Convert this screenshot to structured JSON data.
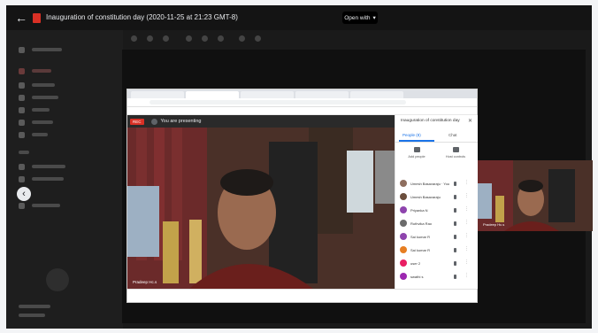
{
  "viewer": {
    "back_glyph": "←",
    "file_title": "Inauguration of constitution day (2020-11-25 at 21:23 GMT-8)",
    "open_with_label": "Open with",
    "open_with_caret": "▾",
    "nav_prev_glyph": "‹"
  },
  "meet": {
    "rec_badge": "REC",
    "presenting_text": "You are presenting",
    "presenter_name": "Pradeep Hc.s",
    "panel_title": "Inauguration of constitution day",
    "panel_close_glyph": "✕",
    "tabs": [
      {
        "label": "People (8)"
      },
      {
        "label": "Chat"
      }
    ],
    "actions": [
      {
        "label": "Add people"
      },
      {
        "label": "Host controls"
      }
    ],
    "participants": [
      {
        "name": "Umesh Basavaraju · You",
        "color": "#8e6e5e"
      },
      {
        "name": "Umesh Basavaraju",
        "color": "#6b4e3d"
      },
      {
        "name": "Priyanka N",
        "color": "#8e44ad"
      },
      {
        "name": "Ruthvika Rao",
        "color": "#6b6b6b"
      },
      {
        "name": "Sai kumar R",
        "color": "#8e44ad"
      },
      {
        "name": "Sai kumar R",
        "color": "#e67e22"
      },
      {
        "name": "user 2",
        "color": "#e91e63"
      },
      {
        "name": "swathi s",
        "color": "#9c27b0"
      }
    ],
    "thumb_name": "Pradeep Hc.s"
  },
  "colors": {
    "accent": "#1a73e8",
    "rec": "#d93025"
  },
  "icons": {
    "back": "arrow-left-icon",
    "doc": "video-file-icon",
    "collapse": "chevron-left-icon"
  }
}
